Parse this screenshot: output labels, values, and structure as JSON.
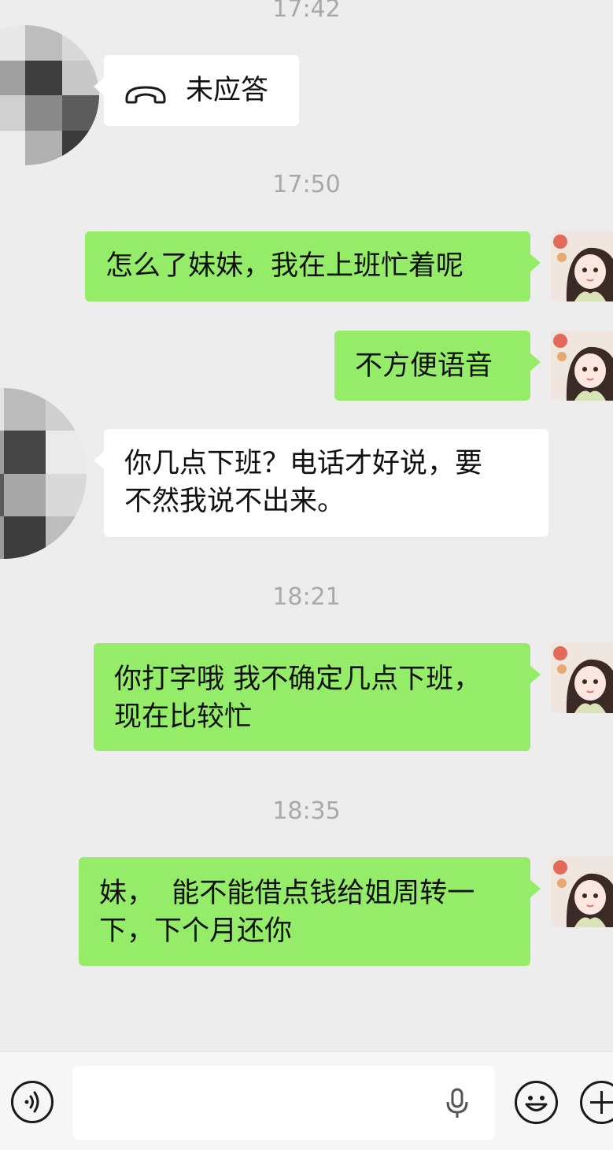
{
  "timestamps": [
    "17:42",
    "17:50",
    "18:21",
    "18:35"
  ],
  "messages": [
    {
      "side": "in",
      "lines": [
        "未应答"
      ],
      "type": "call",
      "icon": "phone-hangup-icon"
    },
    {
      "side": "out",
      "lines": [
        "怎么了妹妹，我在上班忙着呢"
      ]
    },
    {
      "side": "out",
      "lines": [
        "不方便语音"
      ]
    },
    {
      "side": "in",
      "lines": [
        "你几点下班？电话才好说，要",
        "不然我说不出来。"
      ]
    },
    {
      "side": "out",
      "lines": [
        "你打字哦 我不确定几点下班，",
        "现在比较忙"
      ]
    },
    {
      "side": "out",
      "lines": [
        "妹，  能不能借点钱给姐周转一",
        "下，下个月还你"
      ]
    }
  ],
  "input_bar": {
    "voice_icon": "voice-mode-icon",
    "input_value": "",
    "mic_icon": "microphone-icon",
    "emoji_icon": "emoji-icon",
    "plus_icon": "plus-icon"
  },
  "colors": {
    "background": "#ededed",
    "outgoing_bubble": "#95ec69",
    "incoming_bubble": "#ffffff",
    "timestamp": "#a9a9a9"
  }
}
